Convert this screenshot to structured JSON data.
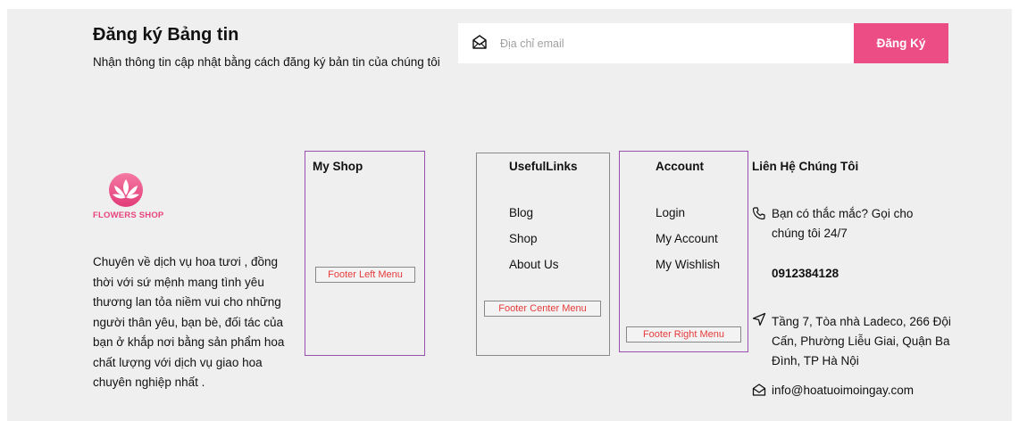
{
  "newsletter": {
    "title": "Đăng ký Bảng tin",
    "description": "Nhận thông tin cập nhật bằng cách đăng ký bản tin của chúng tôi",
    "email_placeholder": "Địa chỉ email",
    "subscribe_label": "Đăng Ký"
  },
  "brand": {
    "logo_text": "FLOWERS SHOP",
    "about": "Chuyên về dịch vụ hoa tươi , đồng thời với sứ mệnh mang tình yêu thương lan tỏa niềm vui cho những người thân yêu, bạn bè, đối tác của bạn ở khắp nơi bằng sản phẩm hoa chất lượng với dịch vụ giao hoa chuyên nghiệp nhất ."
  },
  "columns": {
    "myshop": {
      "heading": "My Shop",
      "menu_tag": "Footer Left Menu"
    },
    "useful": {
      "heading": "UsefulLinks",
      "links": [
        "Blog",
        "Shop",
        "About Us"
      ],
      "menu_tag": "Footer Center Menu"
    },
    "account": {
      "heading": "Account",
      "links": [
        "Login",
        "My Account",
        "My Wishlish"
      ],
      "menu_tag": "Footer Right Menu"
    },
    "contact": {
      "heading": "Liên Hệ Chúng Tôi",
      "question_line1": "Bạn có thắc mắc? Gọi cho",
      "question_line2": "chúng tôi 24/7",
      "phone": "0912384128",
      "address_line1": "Tầng 7, Tòa nhà Ladeco, 266 Đội",
      "address_line2": "Cấn, Phường Liễu Giai, Quận Ba",
      "address_line3": "Đình, TP Hà Nội",
      "email": "info@hoatuoimoingay.com"
    }
  },
  "colors": {
    "accent": "#ec4d84",
    "panel_bg": "#efefef",
    "menu_box_border": "#9b4fb0",
    "menu_tag_text": "#e53b3b"
  },
  "icons": {
    "email_field": "envelope-icon",
    "phone": "phone-icon",
    "address": "location-arrow-icon",
    "email": "envelope-icon"
  }
}
